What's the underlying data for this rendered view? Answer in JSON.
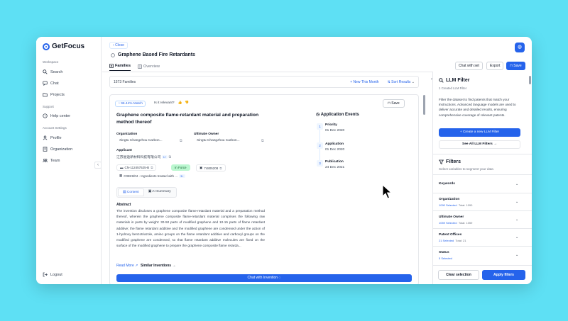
{
  "app": {
    "name": "GetFocus"
  },
  "sidebar": {
    "workspace_label": "Workspace",
    "workspace_items": [
      {
        "label": "Search",
        "icon": "search-icon"
      },
      {
        "label": "Chat",
        "icon": "chat-icon"
      },
      {
        "label": "Projects",
        "icon": "folder-icon"
      }
    ],
    "support_label": "Support",
    "support_items": [
      {
        "label": "Help center",
        "icon": "help-icon"
      }
    ],
    "account_label": "Account Settings",
    "account_items": [
      {
        "label": "Profile",
        "icon": "user-icon"
      },
      {
        "label": "Organization",
        "icon": "building-icon"
      },
      {
        "label": "Team",
        "icon": "team-icon"
      }
    ],
    "logout_label": "Logout"
  },
  "header": {
    "close_label": "Close",
    "title": "Graphene Based Fire Retardants",
    "tabs": [
      {
        "label": "Families"
      },
      {
        "label": "Overview"
      }
    ],
    "chat_with_set": "Chat with set",
    "export": "Export",
    "save": "Save"
  },
  "results": {
    "count": "1573 Families",
    "new_this_month": "New This Month",
    "sort": "Sort Results"
  },
  "patent": {
    "match": "96.44% Match",
    "relevant": "Is it relevant?",
    "save": "Save",
    "title": "Graphene composite flame-retardant material and preparation method thereof",
    "organization_label": "Organization",
    "organization_value": "Xingtu Changzhou Carbon...",
    "owner_label": "Ultimate Owner",
    "owner_value": "Xingtu Changzhou Carbon...",
    "applicant_label": "Applicant",
    "applicant_value": "江苏星途新材料科技有限公司",
    "applicant_badge": "1+",
    "pub_number": "CN-112457525-B",
    "status": "In Force",
    "family_id": "74805208",
    "cpc": "C08K9/04 - Ingredients treated with ...",
    "cpc_badge": "3+",
    "content_tab": "Content",
    "ai_tab": "AI Summary",
    "abstract_label": "Abstract",
    "abstract": "The invention discloses a graphene composite flame-retardant material and a preparation method thereof, wherein the graphene composite flame-retardant material comprises the following raw materials in parts by weight: 30-50 parts of modified graphene and 10-15 parts of flame retardant additive; the flame retardant additive and the modified graphene are condensed under the action of 1-hydroxy benzotriazole, amino groups on the flame retardant additive and carboxyl groups on the modified graphene are condensed, so that flame retardant additive molecules are fixed on the surface of the modified graphene to prepare the graphene composite flame retarda...",
    "read_more": "Read More",
    "similar": "Similar Inventions",
    "chat_invention": "Chat with Invention",
    "events_title": "Application Events",
    "events": [
      {
        "num": "1",
        "label": "Priority",
        "date": "01 Dec 2020"
      },
      {
        "num": "2",
        "label": "Application",
        "date": "01 Dec 2020"
      },
      {
        "num": "3",
        "label": "Publication",
        "date": "24 Dec 2021"
      }
    ]
  },
  "llm_filter": {
    "title": "LLM Filter",
    "subtitle": "1 Created LLM Filter",
    "description": "Filter the dataset to find patents that match your instructions. Advanced language models are used to deliver accurate and detailed results, ensuring comprehensive coverage of relevant patents.",
    "create_btn": "Create a new LLM Filter",
    "see_all": "See All LLM Filters"
  },
  "filters": {
    "title": "Filters",
    "subtitle": "Select variables to segment your data",
    "sections": [
      {
        "label": "Keywords",
        "selected": "",
        "total": ""
      },
      {
        "label": "Organization",
        "selected": "1090 Selected",
        "total": "Total: 1090"
      },
      {
        "label": "Ultimate Owner",
        "selected": "1059 Selected",
        "total": "Total: 1059"
      },
      {
        "label": "Patent Offices",
        "selected": "21 Selected",
        "total": "Total: 21"
      },
      {
        "label": "Status",
        "selected": "5 Selected",
        "total": ""
      }
    ],
    "clear": "Clear selection",
    "apply": "Apply filters"
  }
}
